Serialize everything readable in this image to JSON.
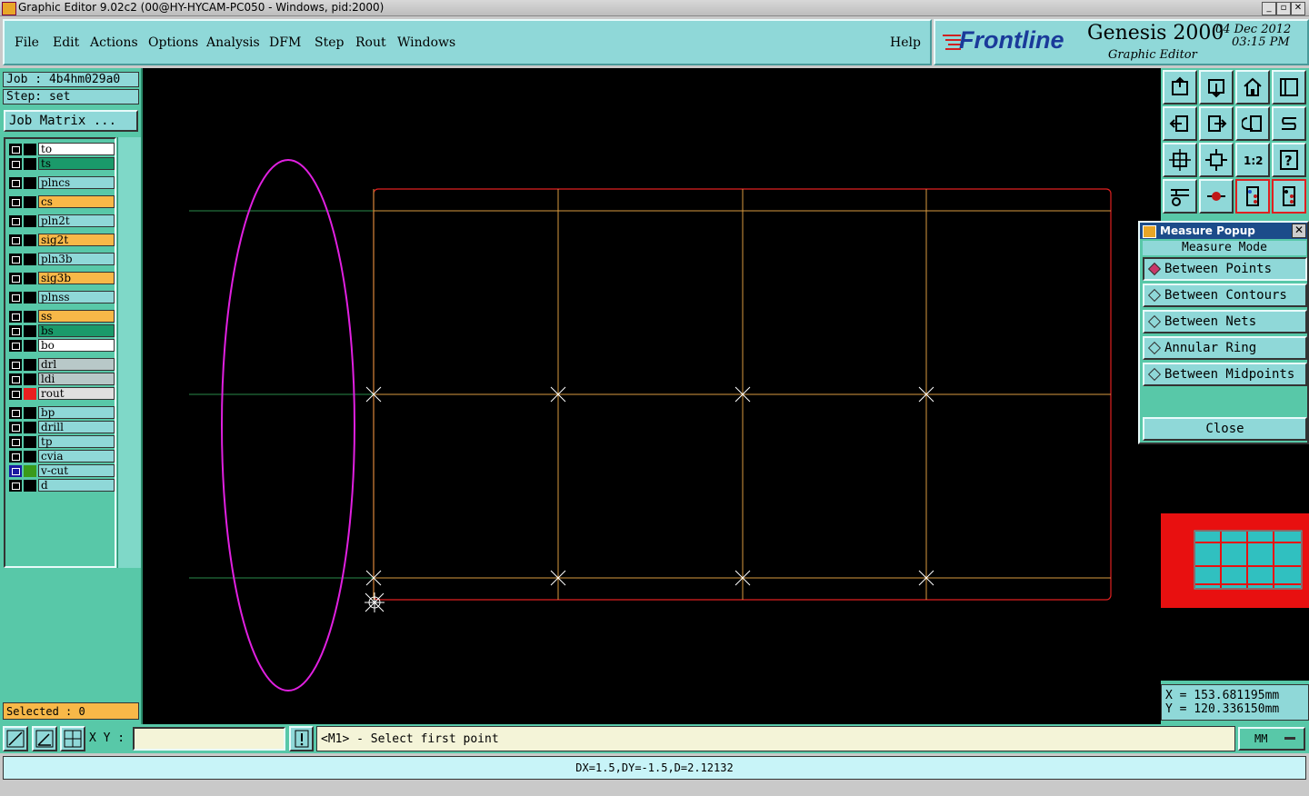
{
  "window": {
    "title": "Graphic Editor 9.02c2 (00@HY-HYCAM-PC050 - Windows, pid:2000)",
    "controls": [
      "_",
      "▫",
      "✕"
    ]
  },
  "menu": {
    "items": [
      "File",
      "Edit",
      "Actions",
      "Options",
      "Analysis",
      "DFM",
      "Step",
      "Rout",
      "Windows"
    ],
    "help": "Help"
  },
  "logo": {
    "brand": "Frontline",
    "product": "Genesis 2000",
    "date": "04 Dec 2012",
    "time": "03:15 PM",
    "subtitle": "Graphic Editor"
  },
  "left": {
    "job": "Job : 4b4hm029a0",
    "step": "Step: set",
    "job_matrix": "Job Matrix ...",
    "selected": "Selected : 0",
    "layers": [
      {
        "name": "to",
        "color": "#ffffff"
      },
      {
        "name": "ts",
        "color": "#1a9a6a"
      },
      {
        "name": "plncs",
        "color": "#8fd8d8"
      },
      {
        "name": "cs",
        "color": "#f8b848"
      },
      {
        "name": "pln2t",
        "color": "#8fd8d8"
      },
      {
        "name": "sig2t",
        "color": "#f8b848"
      },
      {
        "name": "pln3b",
        "color": "#8fd8d8"
      },
      {
        "name": "sig3b",
        "color": "#f8b848"
      },
      {
        "name": "plnss",
        "color": "#8fd8d8"
      },
      {
        "name": "ss",
        "color": "#f8b848"
      },
      {
        "name": "bs",
        "color": "#1a9a6a"
      },
      {
        "name": "bo",
        "color": "#ffffff"
      },
      {
        "name": "drl",
        "color": "#b8c8c8"
      },
      {
        "name": "ldi",
        "color": "#b8c8c8"
      },
      {
        "name": "rout",
        "color": "#e0e0e0"
      },
      {
        "name": "bp",
        "color": "#8fd8d8"
      },
      {
        "name": "drill",
        "color": "#8fd8d8"
      },
      {
        "name": "tp",
        "color": "#8fd8d8"
      },
      {
        "name": "cvia",
        "color": "#8fd8d8"
      },
      {
        "name": "v-cut",
        "color": "#8fd8d8"
      },
      {
        "name": "d",
        "color": "#8fd8d8"
      }
    ]
  },
  "popup": {
    "title": "Measure Popup",
    "mode_label": "Measure Mode",
    "options": [
      "Between Points",
      "Between Contours",
      "Between Nets",
      "Annular Ring",
      "Between Midpoints"
    ],
    "selected": "Between Points",
    "close": "Close"
  },
  "coords": {
    "x": "X = 153.681195mm",
    "y": "Y = 120.336150mm"
  },
  "bottom": {
    "xy_label": "X Y :",
    "xy_value": "",
    "prompt": "<M1> - Select first point",
    "units": "MM",
    "status": "DX=1.5,DY=-1.5,D=2.12132"
  },
  "toolbar_icons": [
    "zoom-home-icon",
    "zoom-fit-icon",
    "home-icon",
    "window-icon",
    "pan-left-icon",
    "pan-right-icon",
    "undo-view-icon",
    "redo-view-icon",
    "zoom-in-icon",
    "zoom-out-icon",
    "scale-1-2-icon",
    "help-icon",
    "tools-icon",
    "snap-icon",
    "net-icon",
    "net-compare-icon"
  ],
  "colors": {
    "panel": "#58c8a8",
    "button": "#8fd8d8",
    "highlight": "#f8b848",
    "canvas": "#000000"
  }
}
